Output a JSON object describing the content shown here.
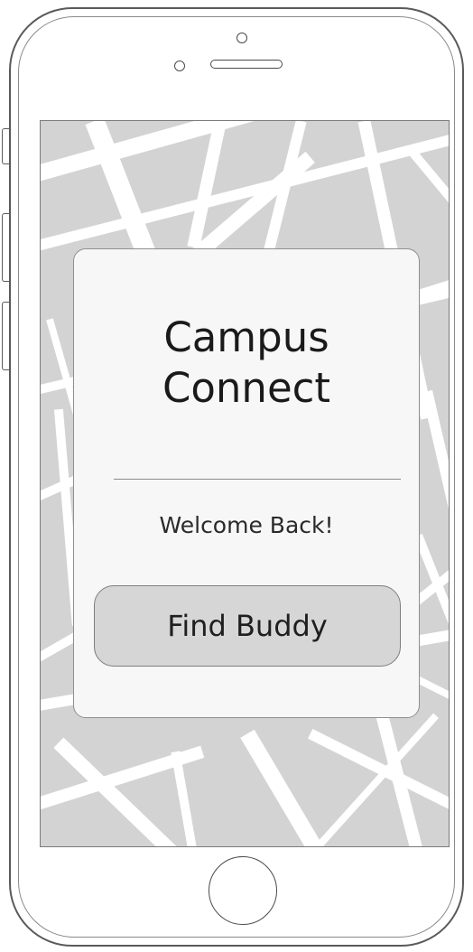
{
  "app": {
    "title_line1": "Campus",
    "title_line2": "Connect",
    "welcome_message": "Welcome Back!"
  },
  "actions": {
    "find_buddy_label": "Find Buddy"
  },
  "theme": {
    "map_background": "#d3d3d3",
    "map_roads": "#ffffff",
    "card_background": "#f7f7f7",
    "button_background": "#d6d6d6",
    "text_color": "#1a1a1a"
  },
  "icons": {
    "home_button": "home-button-icon",
    "front_camera": "camera-icon",
    "earpiece": "speaker-icon"
  }
}
